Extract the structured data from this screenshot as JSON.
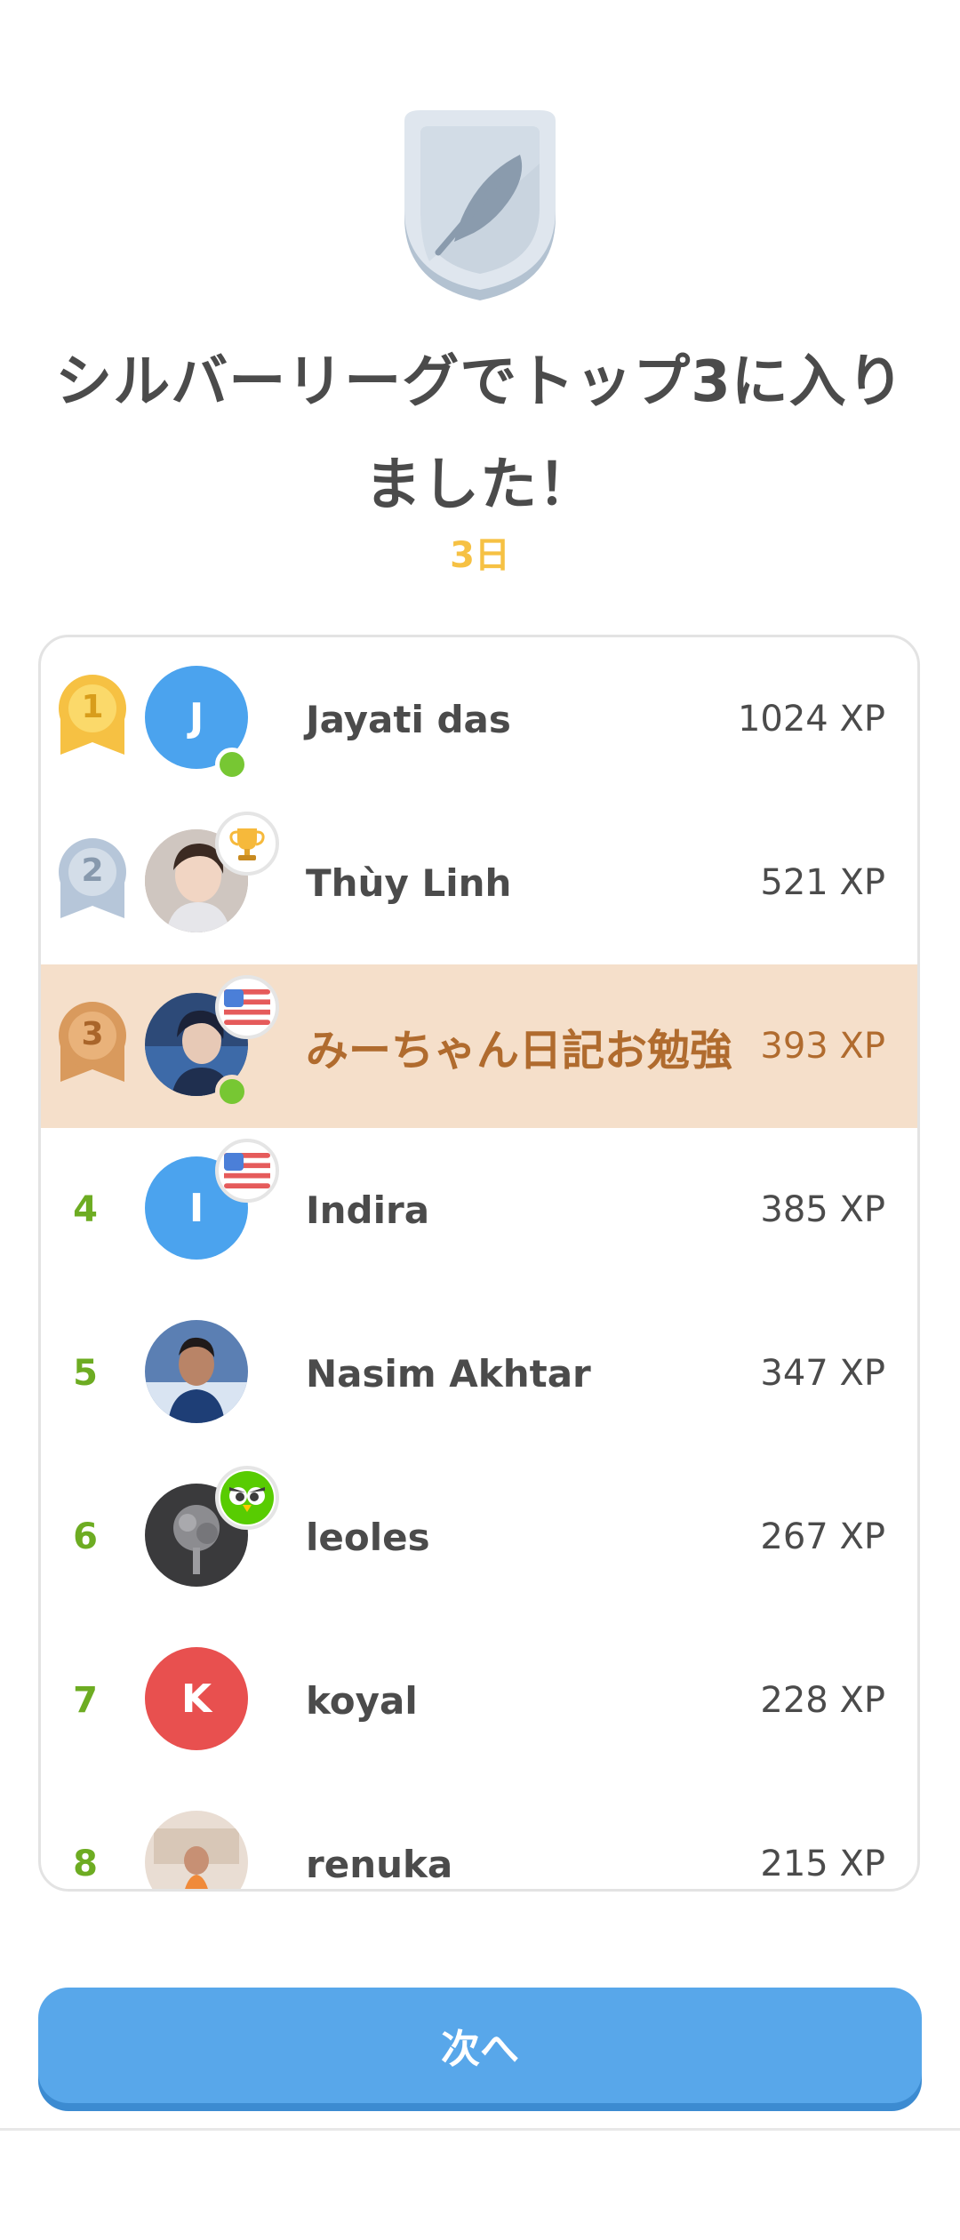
{
  "header": {
    "league_badge_icon": "silver-league-feather-shield-icon",
    "title_line1": "シルバーリーグでトップ3に入り",
    "title_line2": "ました！",
    "days_left": "3日"
  },
  "leaderboard": {
    "rows": [
      {
        "rank": "1",
        "name": "Jayati das",
        "xp": "1024 XP",
        "avatar_letter": "J",
        "avatar_color": "#4ba3ee",
        "medal": "gold",
        "online": true
      },
      {
        "rank": "2",
        "name": "Thùy Linh",
        "xp": "521 XP",
        "avatar_photo": true,
        "medal": "silver",
        "badge": "trophy-icon"
      },
      {
        "rank": "3",
        "name": "みーちゃん日記お勉強",
        "xp": "393 XP",
        "avatar_photo": true,
        "medal": "bronze",
        "badge": "us-flag-icon",
        "online": true,
        "is_current_user": true
      },
      {
        "rank": "4",
        "name": "Indira",
        "xp": "385 XP",
        "avatar_letter": "I",
        "avatar_color": "#4ba3ee",
        "badge": "us-flag-icon"
      },
      {
        "rank": "5",
        "name": "Nasim Akhtar",
        "xp": "347 XP",
        "avatar_photo": true
      },
      {
        "rank": "6",
        "name": "leoles",
        "xp": "267 XP",
        "avatar_photo": true,
        "badge": "duo-owl-icon"
      },
      {
        "rank": "7",
        "name": "koyal",
        "xp": "228 XP",
        "avatar_letter": "K",
        "avatar_color": "#e8504f"
      },
      {
        "rank": "8",
        "name": "renuka",
        "xp": "215 XP",
        "avatar_photo": true
      }
    ]
  },
  "footer": {
    "next_label": "次へ"
  },
  "colors": {
    "accent_blue": "#58a7ea",
    "rank_green": "#6dac22",
    "highlight_row": "#f5dfca",
    "gold": "#f6c143",
    "silver": "#b6c6d9",
    "bronze": "#d99a5d"
  }
}
